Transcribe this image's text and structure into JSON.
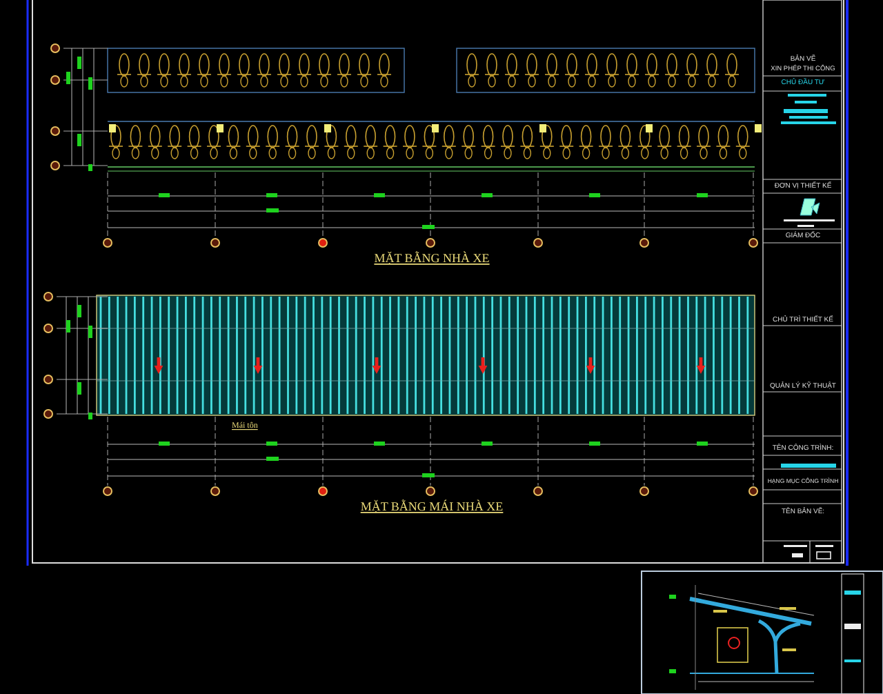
{
  "plans": [
    {
      "title": "MẶT BẰNG NHÀ XE"
    },
    {
      "title": "MẶT BẰNG MÁI NHÀ XE",
      "callout": "Mái tôn"
    }
  ],
  "title_block": [
    {
      "text": "BẢN VẼ",
      "kind": "label"
    },
    {
      "text": "XIN PHÉP THI CÔNG",
      "kind": "label"
    },
    {
      "text": "CHỦ ĐẦU TƯ",
      "kind": "value"
    },
    {
      "text": "ĐƠN VỊ THIẾT KẾ",
      "kind": "label"
    },
    {
      "text": "GIÁM ĐỐC",
      "kind": "label"
    },
    {
      "text": "CHỦ TRÌ THIẾT KẾ",
      "kind": "label"
    },
    {
      "text": "QUẢN LÝ KỸ THUẬT",
      "kind": "label"
    },
    {
      "text": "TÊN CÔNG TRÌNH:",
      "kind": "label"
    },
    {
      "text": "HẠNG MỤC CÔNG TRÌNH",
      "kind": "label"
    },
    {
      "text": "TÊN BẢN VẼ:",
      "kind": "label"
    }
  ]
}
